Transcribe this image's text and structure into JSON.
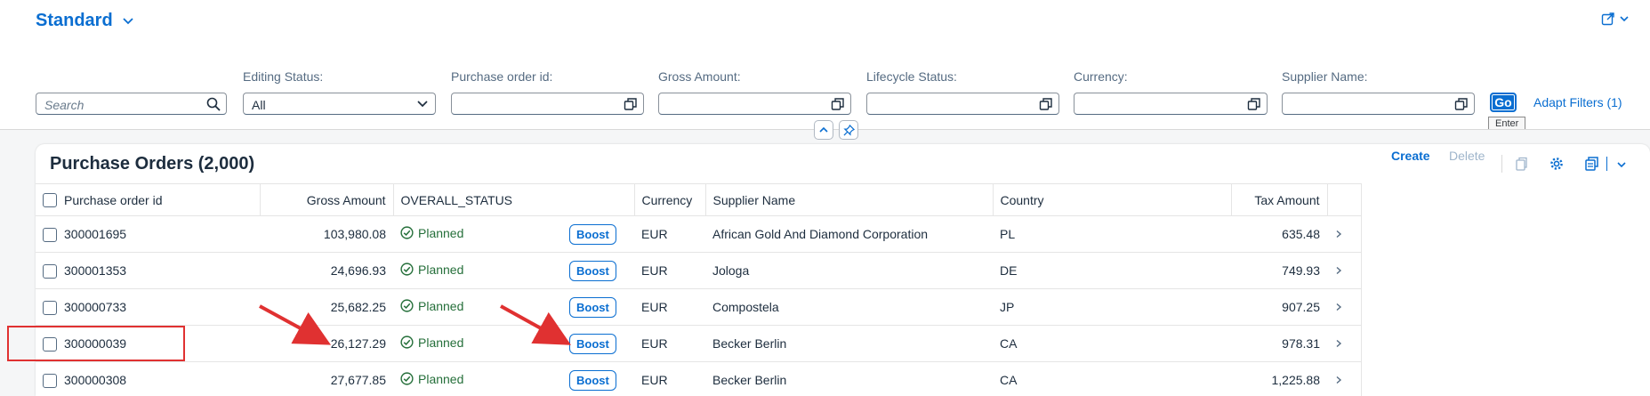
{
  "variant": {
    "title": "Standard"
  },
  "filters": {
    "search": {
      "placeholder": "Search"
    },
    "editing_status": {
      "label": "Editing Status:",
      "value": "All"
    },
    "purchase_order_id": {
      "label": "Purchase order id:",
      "value": ""
    },
    "gross_amount": {
      "label": "Gross Amount:",
      "value": ""
    },
    "lifecycle_status": {
      "label": "Lifecycle Status:",
      "value": ""
    },
    "currency": {
      "label": "Currency:",
      "value": ""
    },
    "supplier_name": {
      "label": "Supplier Name:",
      "value": ""
    },
    "go_label": "Go",
    "go_tooltip": "Enter",
    "adapt_filters": "Adapt Filters (1)"
  },
  "table": {
    "title": "Purchase Orders (2,000)",
    "toolbar": {
      "create": "Create",
      "delete": "Delete"
    },
    "columns": [
      "Purchase order id",
      "Gross Amount",
      "OVERALL_STATUS",
      "",
      "Currency",
      "Supplier Name",
      "Country",
      "Tax Amount"
    ],
    "rows": [
      {
        "id": "300001695",
        "gross": "103,980.08",
        "status": "Planned",
        "action": "Boost",
        "currency": "EUR",
        "supplier": "African Gold And Diamond Corporation",
        "country": "PL",
        "tax": "635.48"
      },
      {
        "id": "300001353",
        "gross": "24,696.93",
        "status": "Planned",
        "action": "Boost",
        "currency": "EUR",
        "supplier": "Jologa",
        "country": "DE",
        "tax": "749.93"
      },
      {
        "id": "300000733",
        "gross": "25,682.25",
        "status": "Planned",
        "action": "Boost",
        "currency": "EUR",
        "supplier": "Compostela",
        "country": "JP",
        "tax": "907.25"
      },
      {
        "id": "300000039",
        "gross": "26,127.29",
        "status": "Planned",
        "action": "Boost",
        "currency": "EUR",
        "supplier": "Becker Berlin",
        "country": "CA",
        "tax": "978.31"
      },
      {
        "id": "300000308",
        "gross": "27,677.85",
        "status": "Planned",
        "action": "Boost",
        "currency": "EUR",
        "supplier": "Becker Berlin",
        "country": "CA",
        "tax": "1,225.88"
      }
    ]
  },
  "colors": {
    "brand": "#0a6ed1",
    "success": "#256f3a",
    "annotation": "#e03131"
  }
}
